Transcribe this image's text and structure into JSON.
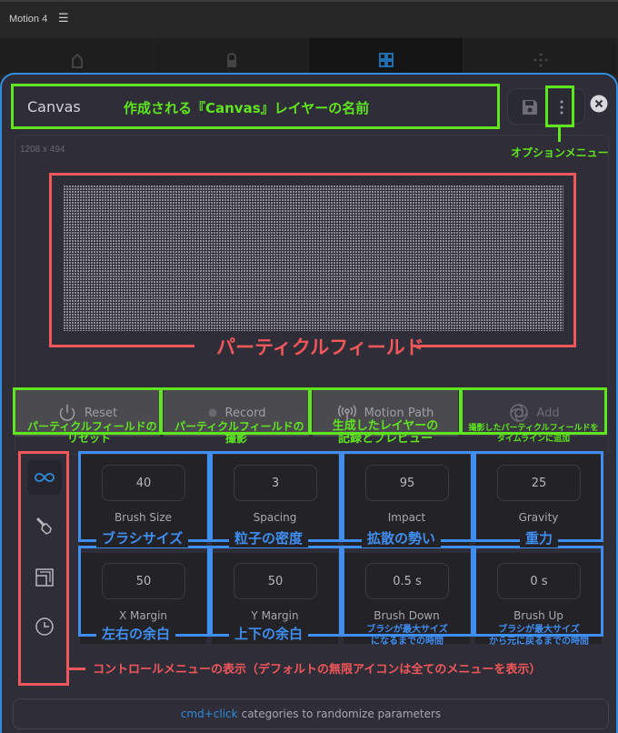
{
  "app": {
    "title": "Motion 4",
    "menu_icon": "hamburger-icon"
  },
  "top_tabs": [
    {
      "name": "home",
      "icon": "home-icon",
      "active": false
    },
    {
      "name": "lock",
      "icon": "lock-icon",
      "active": false
    },
    {
      "name": "grid",
      "icon": "grid-icon",
      "active": true
    },
    {
      "name": "move",
      "icon": "move-icon",
      "active": false
    }
  ],
  "panel": {
    "layer_name": "Canvas",
    "dimensions": "1208 x 494",
    "accent_color": "#2f8ddc"
  },
  "actions": [
    {
      "label": "Reset",
      "icon": "power-icon",
      "enabled": true
    },
    {
      "label": "Record",
      "icon": "record-dot-icon",
      "enabled": true
    },
    {
      "label": "Motion Path",
      "icon": "broadcast-icon",
      "enabled": true
    },
    {
      "label": "Add",
      "icon": "aperture-icon",
      "enabled": false
    }
  ],
  "sidebar": [
    {
      "name": "all",
      "icon": "infinity-icon",
      "active": true
    },
    {
      "name": "brush",
      "icon": "brush-icon",
      "active": false
    },
    {
      "name": "margin",
      "icon": "margin-icon",
      "active": false
    },
    {
      "name": "time",
      "icon": "clock-icon",
      "active": false
    }
  ],
  "params": [
    {
      "label": "Brush Size",
      "value": "40"
    },
    {
      "label": "Spacing",
      "value": "3"
    },
    {
      "label": "Impact",
      "value": "95"
    },
    {
      "label": "Gravity",
      "value": "25"
    },
    {
      "label": "X Margin",
      "value": "50"
    },
    {
      "label": "Y Margin",
      "value": "50"
    },
    {
      "label": "Brush Down",
      "value": "0.5 s"
    },
    {
      "label": "Brush Up",
      "value": "0 s"
    }
  ],
  "hint": {
    "accent": "cmd+click",
    "text": "categories to randomize parameters"
  },
  "annotations": {
    "layer_name": "作成される『Canvas』レイヤーの名前",
    "option_menu": "オプションメニュー",
    "particle_field": "パーティクルフィールド",
    "reset": [
      "パーティクルフィールドの",
      "リセット"
    ],
    "record": [
      "パーティクルフィールドの",
      "撮影"
    ],
    "motion_path": [
      "生成したレイヤーの",
      "記録とプレビュー"
    ],
    "add": [
      "撮影したパーティクルフィールドを",
      "タイムラインに追加"
    ],
    "params": [
      "ブラシサイズ",
      "粒子の密度",
      "拡散の勢い",
      "重力",
      "左右の余白",
      "上下の余白"
    ],
    "brush_down": [
      "ブラシが最大サイズ",
      "になるまでの時間"
    ],
    "brush_up": [
      "ブラシが最大サイズ",
      "から元に戻るまでの時間"
    ],
    "sidebar": "コントロールメニューの表示（デフォルトの無限アイコンは全てのメニューを表示）"
  }
}
